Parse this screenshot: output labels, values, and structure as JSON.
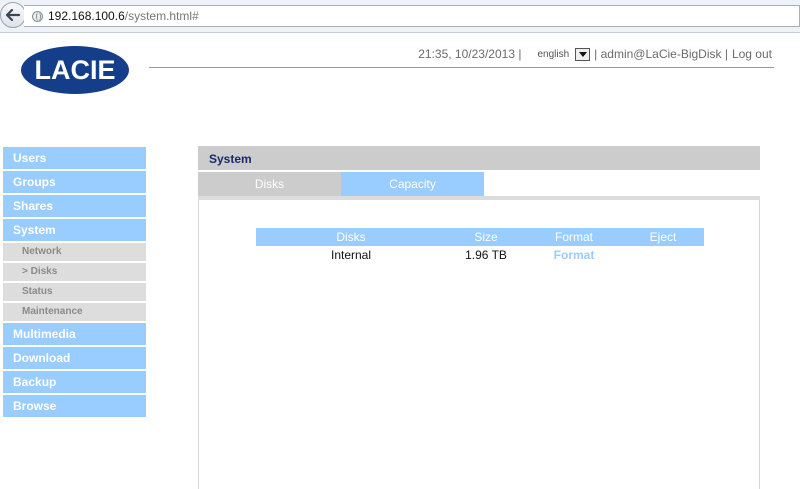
{
  "browser": {
    "url_host": "192.168.100.6",
    "url_path": "/system.html#"
  },
  "header": {
    "logo_text": "LACIE",
    "datetime": "21:35, 10/23/2013 |",
    "language": "english",
    "user_info": "| admin@LaCie-BigDisk |",
    "logout_label": "Log out"
  },
  "sidebar": {
    "items": [
      {
        "label": "Users",
        "type": "main"
      },
      {
        "label": "Groups",
        "type": "main"
      },
      {
        "label": "Shares",
        "type": "main"
      },
      {
        "label": "System",
        "type": "main"
      },
      {
        "label": "Network",
        "type": "sub"
      },
      {
        "label": "> Disks",
        "type": "sub"
      },
      {
        "label": "Status",
        "type": "sub"
      },
      {
        "label": "Maintenance",
        "type": "sub"
      },
      {
        "label": "Multimedia",
        "type": "main"
      },
      {
        "label": "Download",
        "type": "main"
      },
      {
        "label": "Backup",
        "type": "main"
      },
      {
        "label": "Browse",
        "type": "main"
      }
    ]
  },
  "panel": {
    "title": "System",
    "tabs": [
      {
        "label": "Disks",
        "active": true
      },
      {
        "label": "Capacity",
        "active": false
      }
    ]
  },
  "table": {
    "headers": [
      "Disks",
      "Size",
      "Format",
      "Eject"
    ],
    "rows": [
      {
        "disk": "Internal",
        "size": "1.96 TB",
        "format": "Format",
        "eject": ""
      }
    ]
  },
  "colors": {
    "nav_blue": "#99ccff",
    "sub_gray": "#dddddd",
    "logo_blue": "#143d8a",
    "title_navy": "#1a2a6c"
  }
}
